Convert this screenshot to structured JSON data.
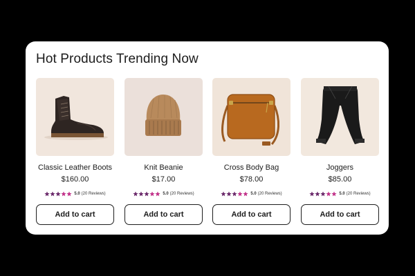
{
  "section": {
    "title": "Hot Products Trending Now"
  },
  "colors": {
    "star_filled": "#6b2a6b",
    "star_pink": "#c2338a",
    "button_border": "#1c1c1c"
  },
  "products": [
    {
      "name": "Classic Leather Boots",
      "price": "$160.00",
      "rating": "5.0",
      "reviews": "(20 Reviews)",
      "cart_label": "Add to cart",
      "image_icon": "boot-icon",
      "stars": 5
    },
    {
      "name": "Knit Beanie",
      "price": "$17.00",
      "rating": "5.0",
      "reviews": "(20 Reviews)",
      "cart_label": "Add to cart",
      "image_icon": "beanie-icon",
      "stars": 5
    },
    {
      "name": "Cross Body Bag",
      "price": "$78.00",
      "rating": "5.0",
      "reviews": "(20 Reviews)",
      "cart_label": "Add to cart",
      "image_icon": "bag-icon",
      "stars": 5
    },
    {
      "name": "Joggers",
      "price": "$85.00",
      "rating": "5.0",
      "reviews": "(20 Reviews)",
      "cart_label": "Add to cart",
      "image_icon": "joggers-icon",
      "stars": 5
    }
  ]
}
